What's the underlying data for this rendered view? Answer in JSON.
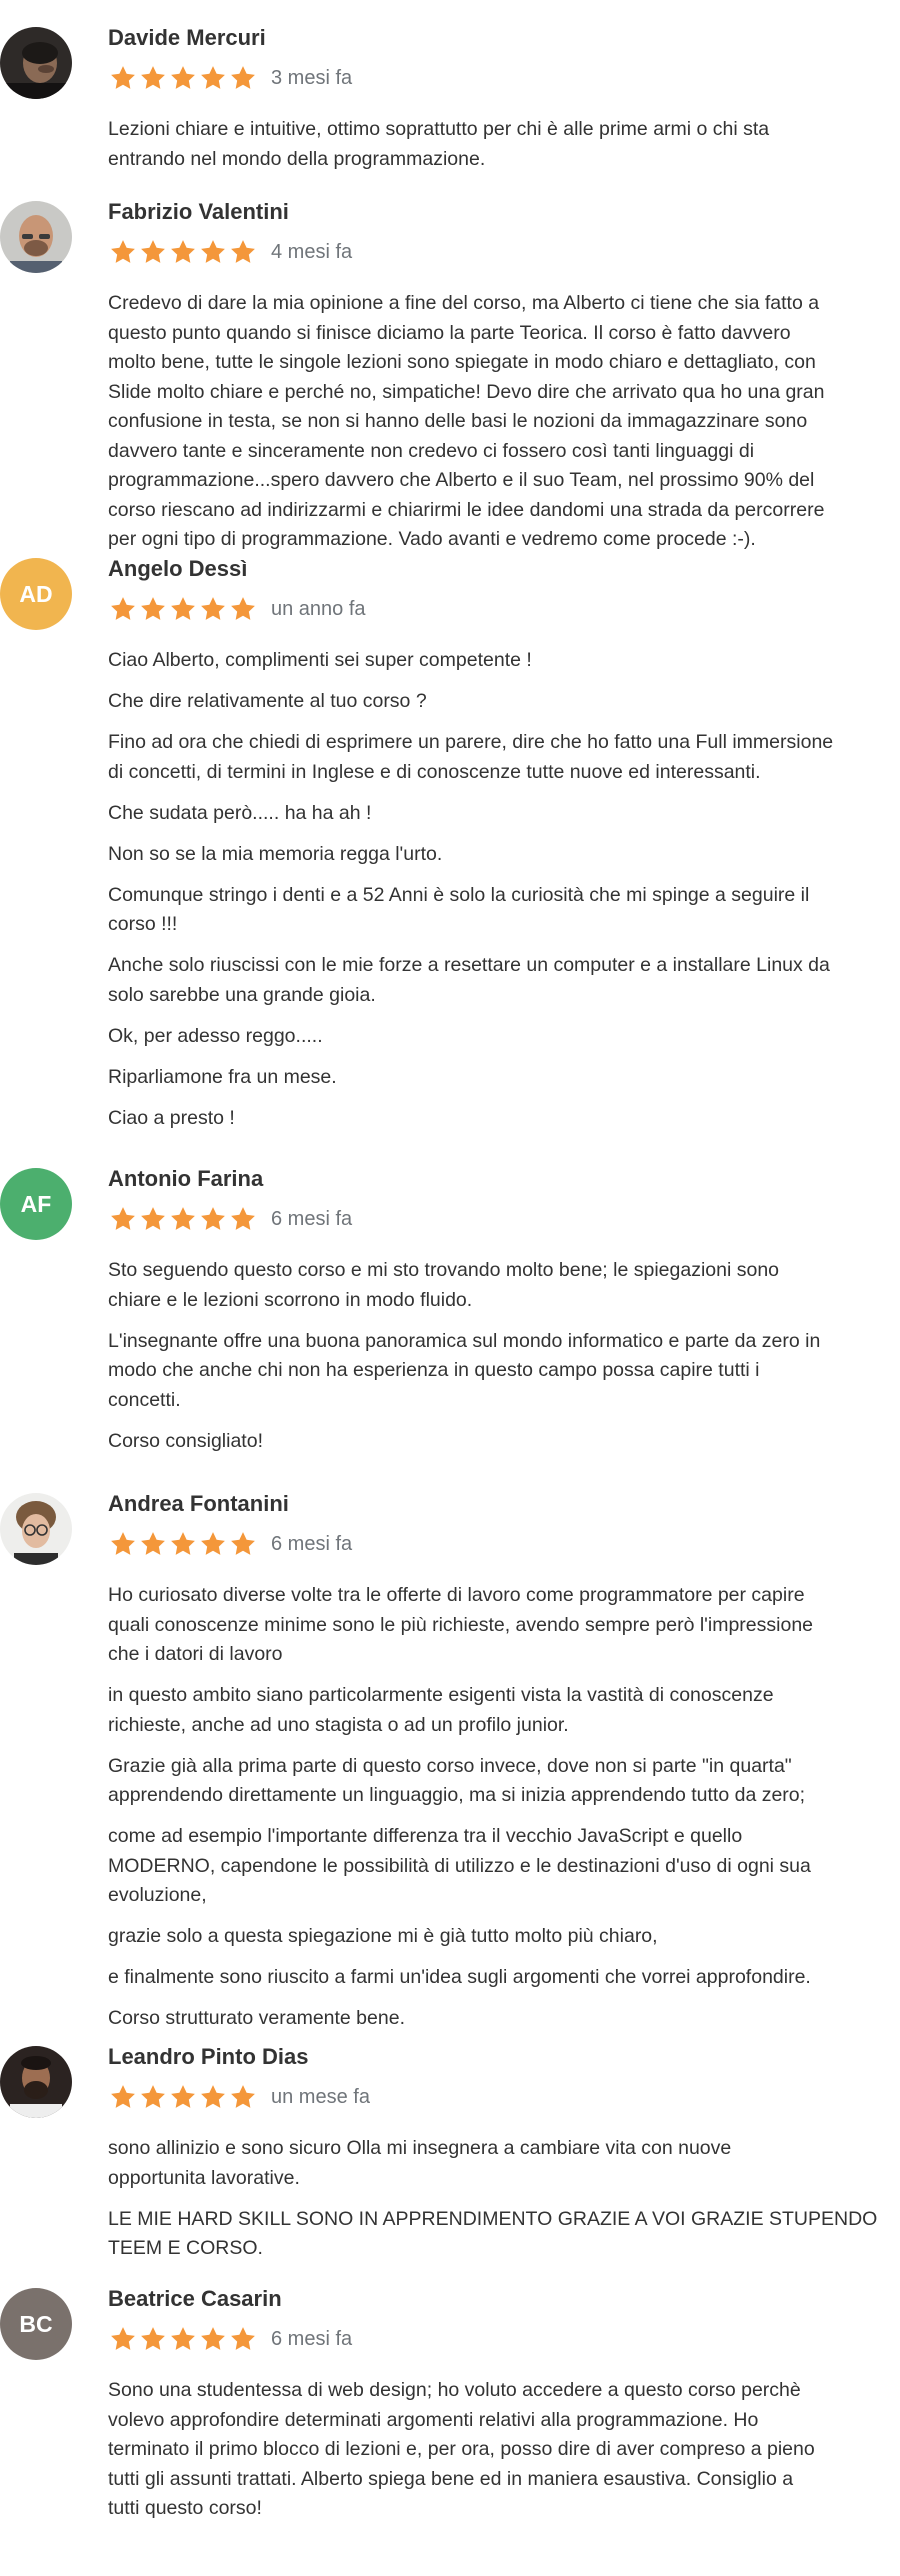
{
  "colors": {
    "star": "#f4973a",
    "text": "#333333",
    "date": "#70757a"
  },
  "reviews": [
    {
      "name": "Davide Mercuri",
      "avatar": {
        "type": "photo",
        "icon": "user-photo-icon"
      },
      "rating": 5,
      "date": "3 mesi fa",
      "paragraphs": [
        [
          "Lezioni chiare e intuitive, ottimo soprattutto per chi è alle prime armi o chi sta",
          "entrando nel mondo della programmazione."
        ]
      ]
    },
    {
      "name": "Fabrizio Valentini",
      "avatar": {
        "type": "photo",
        "icon": "user-photo-icon"
      },
      "rating": 5,
      "date": "4 mesi fa",
      "paragraphs": [
        [
          "Credevo di dare la mia opinione a fine del corso, ma Alberto ci tiene che sia fatto a",
          "questo punto quando si finisce diciamo la parte Teorica. Il corso è fatto davvero",
          "molto bene, tutte le singole lezioni sono spiegate in modo chiaro e dettagliato, con",
          "Slide molto chiare e perché no, simpatiche! Devo dire che arrivato qua ho una gran",
          "confusione in testa, se non si hanno delle basi le nozioni da immagazzinare sono",
          "davvero tante e sinceramente non credevo ci fossero così tanti linguaggi di",
          "programmazione...spero davvero che Alberto e il suo Team, nel prossimo 90% del",
          "corso riescano ad indirizzarmi e chiarirmi le idee dandomi una strada da percorrere",
          "per ogni tipo di programmazione. Vado avanti e vedremo come procede :-)."
        ]
      ]
    },
    {
      "name": "Angelo Dessì",
      "avatar": {
        "type": "initials",
        "initials": "AD",
        "color": "#f1b54f"
      },
      "rating": 5,
      "date": "un anno fa",
      "paragraphs": [
        [
          "Ciao Alberto, complimenti sei super competente !"
        ],
        [
          "Che dire relativamente al tuo corso ?"
        ],
        [
          "Fino ad ora che chiedi di esprimere un parere, dire che ho fatto una Full immersione",
          "di concetti, di termini in Inglese e di conoscenze tutte nuove ed interessanti."
        ],
        [
          "Che sudata però..... ha ha ah !"
        ],
        [
          "Non so se la mia memoria regga l'urto."
        ],
        [
          "Comunque stringo i denti e a 52 Anni è solo la curiosità che mi spinge a seguire il",
          "corso !!!"
        ],
        [
          "Anche solo riuscissi con le mie forze a resettare un computer e a installare Linux da",
          "solo sarebbe una grande gioia."
        ],
        [
          "Ok, per adesso reggo....."
        ],
        [
          "Riparliamone fra un mese."
        ],
        [
          "Ciao a presto !"
        ]
      ]
    },
    {
      "name": "Antonio Farina",
      "avatar": {
        "type": "initials",
        "initials": "AF",
        "color": "#4caf6e"
      },
      "rating": 5,
      "date": "6 mesi fa",
      "paragraphs": [
        [
          "Sto seguendo questo corso e mi sto trovando molto bene; le spiegazioni sono",
          "chiare e le lezioni scorrono in modo fluido."
        ],
        [
          "L'insegnante offre una buona panoramica sul mondo informatico e parte da zero in",
          "modo che anche chi non ha esperienza in questo campo possa capire tutti i",
          "concetti."
        ],
        [
          "Corso consigliato!"
        ]
      ]
    },
    {
      "name": "Andrea Fontanini",
      "avatar": {
        "type": "photo",
        "icon": "user-photo-icon"
      },
      "rating": 5,
      "date": "6 mesi fa",
      "paragraphs": [
        [
          "Ho curiosato diverse volte tra le offerte di lavoro come programmatore per capire",
          "quali conoscenze minime sono le più richieste, avendo sempre però l'impressione",
          "che i datori di lavoro"
        ],
        [
          "in questo ambito siano particolarmente esigenti vista la vastità di conoscenze",
          "richieste, anche ad uno stagista o ad un profilo junior."
        ],
        [
          "Grazie già alla prima parte di questo corso invece, dove non si parte \"in quarta\"",
          "apprendendo direttamente un linguaggio, ma si inizia apprendendo tutto da zero;"
        ],
        [
          "come ad esempio l'importante differenza tra il vecchio JavaScript e quello",
          "MODERNO, capendone le possibilità di utilizzo e le destinazioni d'uso di ogni sua",
          "evoluzione,"
        ],
        [
          "grazie solo a questa spiegazione mi è già tutto molto più chiaro,"
        ],
        [
          "e finalmente sono riuscito a farmi un'idea sugli argomenti che vorrei approfondire."
        ],
        [
          "Corso strutturato veramente bene."
        ]
      ]
    },
    {
      "name": "Leandro Pinto Dias",
      "avatar": {
        "type": "photo",
        "icon": "user-photo-icon"
      },
      "rating": 5,
      "date": "un mese fa",
      "paragraphs": [
        [
          "sono allinizio e sono sicuro Olla mi insegnera a cambiare vita con nuove",
          "opportunita lavorative."
        ],
        [
          "LE MIE HARD SKILL SONO IN APPRENDIMENTO GRAZIE A VOI GRAZIE STUPENDO",
          "TEEM E CORSO."
        ]
      ]
    },
    {
      "name": "Beatrice Casarin",
      "avatar": {
        "type": "initials",
        "initials": "BC",
        "color": "#7a716c"
      },
      "rating": 5,
      "date": "6 mesi fa",
      "paragraphs": [
        [
          "Sono una studentessa di web design; ho voluto accedere a questo corso perchè",
          "volevo approfondire determinati argomenti relativi alla programmazione. Ho",
          "terminato il primo blocco di lezioni e, per ora, posso dire di aver compreso a pieno",
          "tutti gli assunti trattati. Alberto spiega bene ed in maniera esaustiva. Consiglio a",
          "tutti questo corso!"
        ]
      ]
    }
  ]
}
